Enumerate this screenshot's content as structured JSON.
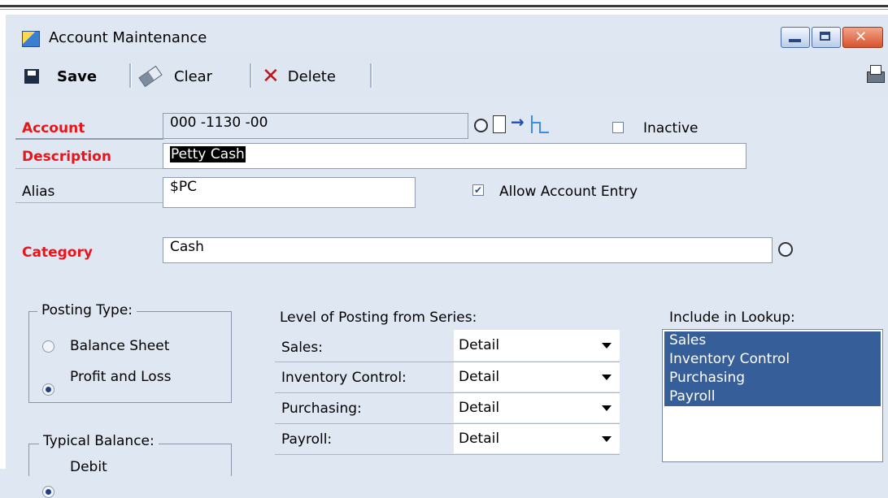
{
  "window": {
    "title": "Account Maintenance"
  },
  "toolbar": {
    "save": "Save",
    "clear": "Clear",
    "delete": "Delete"
  },
  "form": {
    "account": {
      "label": "Account",
      "value": "000 -1130 -00"
    },
    "inactive": {
      "label": "Inactive",
      "checked": false
    },
    "description": {
      "label": "Description",
      "value": "Petty Cash"
    },
    "alias": {
      "label": "Alias",
      "value": "$PC"
    },
    "allow_entry": {
      "label": "Allow Account Entry",
      "checked": true
    },
    "category": {
      "label": "Category",
      "value": "Cash"
    }
  },
  "posting_type": {
    "title": "Posting Type:",
    "options": [
      "Balance Sheet",
      "Profit and Loss"
    ],
    "selected": "Profit and Loss"
  },
  "typical_balance": {
    "title": "Typical Balance:",
    "option": "Debit"
  },
  "level_of_posting": {
    "title": "Level of Posting from Series:",
    "rows": [
      {
        "label": "Sales:",
        "value": "Detail"
      },
      {
        "label": "Inventory Control:",
        "value": "Detail"
      },
      {
        "label": "Purchasing:",
        "value": "Detail"
      },
      {
        "label": "Payroll:",
        "value": "Detail"
      }
    ]
  },
  "lookup": {
    "title": "Include in Lookup:",
    "items": [
      "Sales",
      "Inventory Control",
      "Purchasing",
      "Payroll"
    ]
  },
  "colors": {
    "required": "#e8151b",
    "selection": "#365f9a",
    "background": "#dfe7f2"
  }
}
